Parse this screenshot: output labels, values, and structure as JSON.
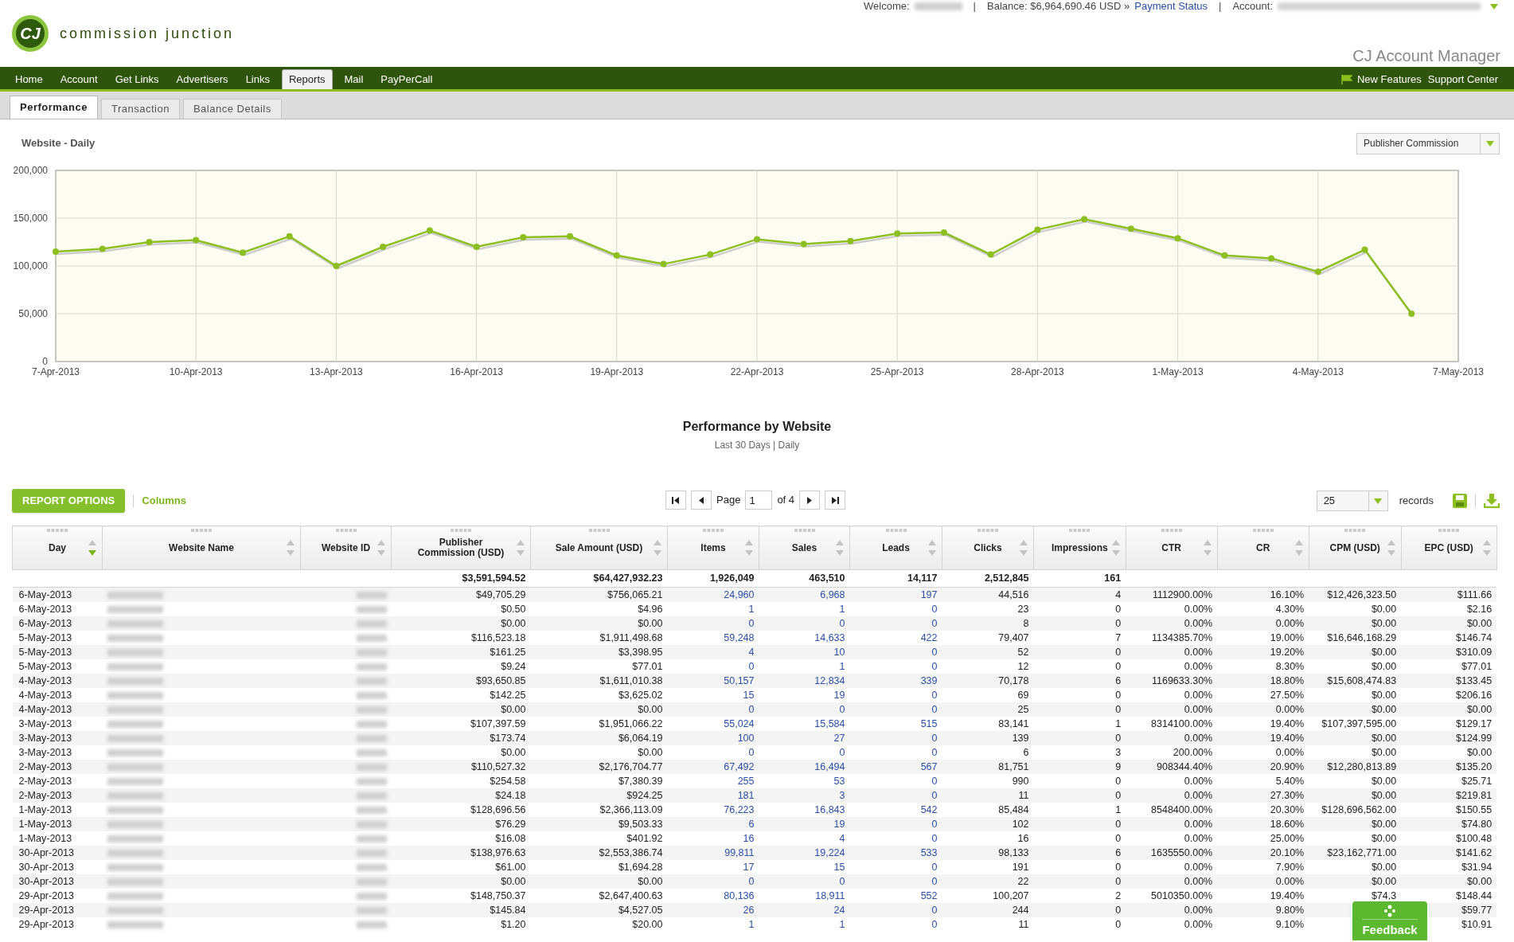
{
  "header": {
    "logo_mark": "CJ",
    "logo_text": "commission junction",
    "welcome_label": "Welcome:",
    "welcome_redacted": true,
    "separator_1": "|",
    "balance": "Balance: $6,964,690.46 USD »",
    "payment_link": "Payment Status",
    "separator_2": "|",
    "account_label": "Account:",
    "account_redacted": true,
    "app_title": "CJ Account Manager"
  },
  "nav": {
    "items": [
      {
        "label": "Home",
        "selected": false
      },
      {
        "label": "Account",
        "selected": false
      },
      {
        "label": "Get Links",
        "selected": false
      },
      {
        "label": "Advertisers",
        "selected": false
      },
      {
        "label": "Links",
        "selected": false
      },
      {
        "label": "Reports",
        "selected": true
      },
      {
        "label": "Mail",
        "selected": false
      },
      {
        "label": "PayPerCall",
        "selected": false
      }
    ],
    "new_features": "New Features",
    "support": "Support Center"
  },
  "subtabs": [
    {
      "label": "Performance",
      "selected": true
    },
    {
      "label": "Transaction",
      "selected": false
    },
    {
      "label": "Balance Details",
      "selected": false
    }
  ],
  "chart_panel": {
    "title": "Website - Daily",
    "metric": "Publisher Commission",
    "chart_data": {
      "type": "line",
      "categories": [
        "7-Apr-2013",
        null,
        null,
        "10-Apr-2013",
        null,
        null,
        "13-Apr-2013",
        null,
        null,
        "16-Apr-2013",
        null,
        null,
        "19-Apr-2013",
        null,
        null,
        "22-Apr-2013",
        null,
        null,
        "25-Apr-2013",
        null,
        null,
        "28-Apr-2013",
        null,
        null,
        "1-May-2013",
        null,
        null,
        "4-May-2013",
        null,
        null,
        "7-May-2013"
      ],
      "grid": true,
      "series": [
        {
          "color": "#8cbf1f",
          "marker": true,
          "values": [
            115000,
            118000,
            125000,
            127000,
            114000,
            131000,
            100000,
            120000,
            137000,
            120000,
            130000,
            131000,
            111000,
            102000,
            112000,
            128000,
            123000,
            126000,
            134000,
            135000,
            112000,
            138000,
            149000,
            139000,
            129000,
            111000,
            108000,
            94000,
            117000,
            50000,
            null
          ]
        }
      ],
      "ylim": [
        0,
        200000
      ],
      "yticks": [
        {
          "value": 0,
          "label": "0"
        },
        {
          "value": 50000,
          "label": "50,000"
        },
        {
          "value": 100000,
          "label": "100,000"
        },
        {
          "value": 150000,
          "label": "150,000"
        },
        {
          "value": 200000,
          "label": "200,000"
        }
      ]
    }
  },
  "report": {
    "title": "Performance by Website",
    "subtitle": "Last 30 Days | Daily",
    "options_button": "REPORT OPTIONS",
    "columns_link": "Columns",
    "page_label": "Page",
    "page_value": "1",
    "page_of": "of 4",
    "per_page": "25",
    "records_label": "records",
    "columns": [
      {
        "label": "Day",
        "sorted": true,
        "link": false,
        "redacted": false
      },
      {
        "label": "Website Name",
        "sorted": false,
        "link": false,
        "redacted": true
      },
      {
        "label": "Website ID",
        "sorted": false,
        "link": false,
        "redacted": true
      },
      {
        "label": "Publisher Commission (USD)",
        "sorted": false,
        "link": false,
        "redacted": false,
        "total": "$3,591,594.52"
      },
      {
        "label": "Sale Amount (USD)",
        "sorted": false,
        "link": false,
        "redacted": false,
        "total": "$64,427,932.23"
      },
      {
        "label": "Items",
        "sorted": false,
        "link": true,
        "redacted": false,
        "total": "1,926,049"
      },
      {
        "label": "Sales",
        "sorted": false,
        "link": true,
        "redacted": false,
        "total": "463,510"
      },
      {
        "label": "Leads",
        "sorted": false,
        "link": true,
        "redacted": false,
        "total": "14,117"
      },
      {
        "label": "Clicks",
        "sorted": false,
        "link": false,
        "redacted": false,
        "total": "2,512,845"
      },
      {
        "label": "Impressions",
        "sorted": false,
        "link": false,
        "redacted": false,
        "total": "161"
      },
      {
        "label": "CTR",
        "sorted": false,
        "link": false,
        "redacted": false
      },
      {
        "label": "CR",
        "sorted": false,
        "link": false,
        "redacted": false
      },
      {
        "label": "CPM (USD)",
        "sorted": false,
        "link": false,
        "redacted": false
      },
      {
        "label": "EPC (USD)",
        "sorted": false,
        "link": false,
        "redacted": false
      }
    ],
    "rows": [
      {
        "day": "6-May-2013",
        "publisher_commission": "$49,705.29",
        "sale_amount": "$756,065.21",
        "items": "24,960",
        "sales": "6,968",
        "leads": "197",
        "clicks": "44,516",
        "impressions": "4",
        "ctr": "1112900.00%",
        "cr": "16.10%",
        "cpm": "$12,426,323.50",
        "epc": "$111.66"
      },
      {
        "day": "6-May-2013",
        "publisher_commission": "$0.50",
        "sale_amount": "$4.96",
        "items": "1",
        "sales": "1",
        "leads": "0",
        "clicks": "23",
        "impressions": "0",
        "ctr": "0.00%",
        "cr": "4.30%",
        "cpm": "$0.00",
        "epc": "$2.16"
      },
      {
        "day": "6-May-2013",
        "publisher_commission": "$0.00",
        "sale_amount": "$0.00",
        "items": "0",
        "sales": "0",
        "leads": "0",
        "clicks": "8",
        "impressions": "0",
        "ctr": "0.00%",
        "cr": "0.00%",
        "cpm": "$0.00",
        "epc": "$0.00"
      },
      {
        "day": "5-May-2013",
        "publisher_commission": "$116,523.18",
        "sale_amount": "$1,911,498.68",
        "items": "59,248",
        "sales": "14,633",
        "leads": "422",
        "clicks": "79,407",
        "impressions": "7",
        "ctr": "1134385.70%",
        "cr": "19.00%",
        "cpm": "$16,646,168.29",
        "epc": "$146.74"
      },
      {
        "day": "5-May-2013",
        "publisher_commission": "$161.25",
        "sale_amount": "$3,398.95",
        "items": "4",
        "sales": "10",
        "leads": "0",
        "clicks": "52",
        "impressions": "0",
        "ctr": "0.00%",
        "cr": "19.20%",
        "cpm": "$0.00",
        "epc": "$310.09"
      },
      {
        "day": "5-May-2013",
        "publisher_commission": "$9.24",
        "sale_amount": "$77.01",
        "items": "0",
        "sales": "1",
        "leads": "0",
        "clicks": "12",
        "impressions": "0",
        "ctr": "0.00%",
        "cr": "8.30%",
        "cpm": "$0.00",
        "epc": "$77.01"
      },
      {
        "day": "4-May-2013",
        "publisher_commission": "$93,650.85",
        "sale_amount": "$1,611,010.38",
        "items": "50,157",
        "sales": "12,834",
        "leads": "339",
        "clicks": "70,178",
        "impressions": "6",
        "ctr": "1169633.30%",
        "cr": "18.80%",
        "cpm": "$15,608,474.83",
        "epc": "$133.45"
      },
      {
        "day": "4-May-2013",
        "publisher_commission": "$142.25",
        "sale_amount": "$3,625.02",
        "items": "15",
        "sales": "19",
        "leads": "0",
        "clicks": "69",
        "impressions": "0",
        "ctr": "0.00%",
        "cr": "27.50%",
        "cpm": "$0.00",
        "epc": "$206.16"
      },
      {
        "day": "4-May-2013",
        "publisher_commission": "$0.00",
        "sale_amount": "$0.00",
        "items": "0",
        "sales": "0",
        "leads": "0",
        "clicks": "25",
        "impressions": "0",
        "ctr": "0.00%",
        "cr": "0.00%",
        "cpm": "$0.00",
        "epc": "$0.00"
      },
      {
        "day": "3-May-2013",
        "publisher_commission": "$107,397.59",
        "sale_amount": "$1,951,066.22",
        "items": "55,024",
        "sales": "15,584",
        "leads": "515",
        "clicks": "83,141",
        "impressions": "1",
        "ctr": "8314100.00%",
        "cr": "19.40%",
        "cpm": "$107,397,595.00",
        "epc": "$129.17"
      },
      {
        "day": "3-May-2013",
        "publisher_commission": "$173.74",
        "sale_amount": "$6,064.19",
        "items": "100",
        "sales": "27",
        "leads": "0",
        "clicks": "139",
        "impressions": "0",
        "ctr": "0.00%",
        "cr": "19.40%",
        "cpm": "$0.00",
        "epc": "$124.99"
      },
      {
        "day": "3-May-2013",
        "publisher_commission": "$0.00",
        "sale_amount": "$0.00",
        "items": "0",
        "sales": "0",
        "leads": "0",
        "clicks": "6",
        "impressions": "3",
        "ctr": "200.00%",
        "cr": "0.00%",
        "cpm": "$0.00",
        "epc": "$0.00"
      },
      {
        "day": "2-May-2013",
        "publisher_commission": "$110,527.32",
        "sale_amount": "$2,176,704.77",
        "items": "67,492",
        "sales": "16,494",
        "leads": "567",
        "clicks": "81,751",
        "impressions": "9",
        "ctr": "908344.40%",
        "cr": "20.90%",
        "cpm": "$12,280,813.89",
        "epc": "$135.20"
      },
      {
        "day": "2-May-2013",
        "publisher_commission": "$254.58",
        "sale_amount": "$7,380.39",
        "items": "255",
        "sales": "53",
        "leads": "0",
        "clicks": "990",
        "impressions": "0",
        "ctr": "0.00%",
        "cr": "5.40%",
        "cpm": "$0.00",
        "epc": "$25.71"
      },
      {
        "day": "2-May-2013",
        "publisher_commission": "$24.18",
        "sale_amount": "$924.25",
        "items": "181",
        "sales": "3",
        "leads": "0",
        "clicks": "11",
        "impressions": "0",
        "ctr": "0.00%",
        "cr": "27.30%",
        "cpm": "$0.00",
        "epc": "$219.81"
      },
      {
        "day": "1-May-2013",
        "publisher_commission": "$128,696.56",
        "sale_amount": "$2,366,113.09",
        "items": "76,223",
        "sales": "16,843",
        "leads": "542",
        "clicks": "85,484",
        "impressions": "1",
        "ctr": "8548400.00%",
        "cr": "20.30%",
        "cpm": "$128,696,562.00",
        "epc": "$150.55"
      },
      {
        "day": "1-May-2013",
        "publisher_commission": "$76.29",
        "sale_amount": "$9,503.33",
        "items": "6",
        "sales": "19",
        "leads": "0",
        "clicks": "102",
        "impressions": "0",
        "ctr": "0.00%",
        "cr": "18.60%",
        "cpm": "$0.00",
        "epc": "$74.80"
      },
      {
        "day": "1-May-2013",
        "publisher_commission": "$16.08",
        "sale_amount": "$401.92",
        "items": "16",
        "sales": "4",
        "leads": "0",
        "clicks": "16",
        "impressions": "0",
        "ctr": "0.00%",
        "cr": "25.00%",
        "cpm": "$0.00",
        "epc": "$100.48"
      },
      {
        "day": "30-Apr-2013",
        "publisher_commission": "$138,976.63",
        "sale_amount": "$2,553,386.74",
        "items": "99,811",
        "sales": "19,224",
        "leads": "533",
        "clicks": "98,133",
        "impressions": "6",
        "ctr": "1635550.00%",
        "cr": "20.10%",
        "cpm": "$23,162,771.00",
        "epc": "$141.62"
      },
      {
        "day": "30-Apr-2013",
        "publisher_commission": "$61.00",
        "sale_amount": "$1,694.28",
        "items": "17",
        "sales": "15",
        "leads": "0",
        "clicks": "191",
        "impressions": "0",
        "ctr": "0.00%",
        "cr": "7.90%",
        "cpm": "$0.00",
        "epc": "$31.94"
      },
      {
        "day": "30-Apr-2013",
        "publisher_commission": "$0.00",
        "sale_amount": "$0.00",
        "items": "0",
        "sales": "0",
        "leads": "0",
        "clicks": "22",
        "impressions": "0",
        "ctr": "0.00%",
        "cr": "0.00%",
        "cpm": "$0.00",
        "epc": "$0.00"
      },
      {
        "day": "29-Apr-2013",
        "publisher_commission": "$148,750.37",
        "sale_amount": "$2,647,400.63",
        "items": "80,136",
        "sales": "18,911",
        "leads": "552",
        "clicks": "100,207",
        "impressions": "2",
        "ctr": "5010350.00%",
        "cr": "19.40%",
        "cpm": "$74,3",
        "epc": "$148.44"
      },
      {
        "day": "29-Apr-2013",
        "publisher_commission": "$145.84",
        "sale_amount": "$4,527.05",
        "items": "26",
        "sales": "24",
        "leads": "0",
        "clicks": "244",
        "impressions": "0",
        "ctr": "0.00%",
        "cr": "9.80%",
        "epc": "$59.77"
      },
      {
        "day": "29-Apr-2013",
        "publisher_commission": "$1.20",
        "sale_amount": "$20.00",
        "items": "1",
        "sales": "1",
        "leads": "0",
        "clicks": "11",
        "impressions": "0",
        "ctr": "0.00%",
        "cr": "9.10%",
        "epc": "$10.91"
      }
    ]
  },
  "feedback": {
    "label": "Feedback"
  }
}
